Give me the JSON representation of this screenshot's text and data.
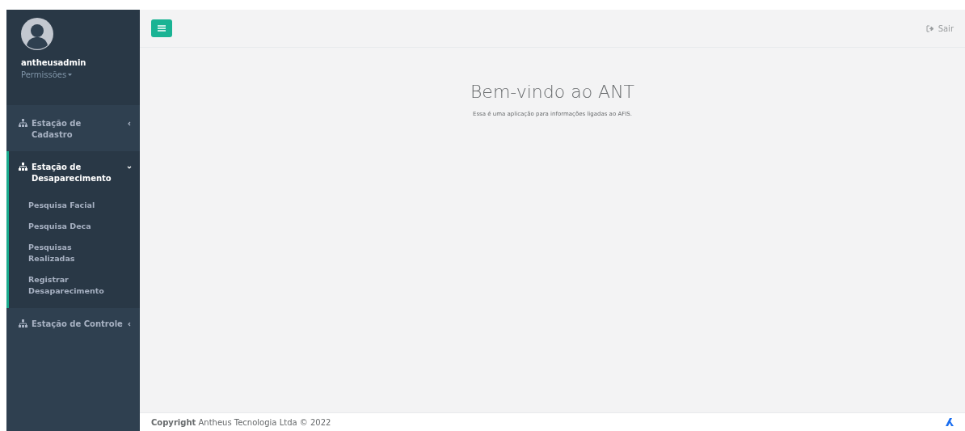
{
  "user": {
    "name": "antheusadmin",
    "role_menu": "Permissões"
  },
  "nav": [
    {
      "label": "Estação de Cadastro",
      "expanded": false,
      "selected": false
    },
    {
      "label": "Estação de Desaparecimento",
      "expanded": true,
      "selected": true,
      "children": [
        {
          "label": "Pesquisa Facial"
        },
        {
          "label": "Pesquisa Deca"
        },
        {
          "label": "Pesquisas Realizadas"
        },
        {
          "label": "Registrar Desaparecimento"
        }
      ]
    },
    {
      "label": "Estação de Controle",
      "expanded": false,
      "selected": false
    }
  ],
  "header": {
    "logout": "Sair"
  },
  "main": {
    "title": "Bem-vindo ao ANT",
    "subtitle": "Essa é uma aplicação para informações ligadas ao AFIS."
  },
  "footer": {
    "text": "**Copyright** Antheus Tecnologia Ltda © 2022"
  }
}
